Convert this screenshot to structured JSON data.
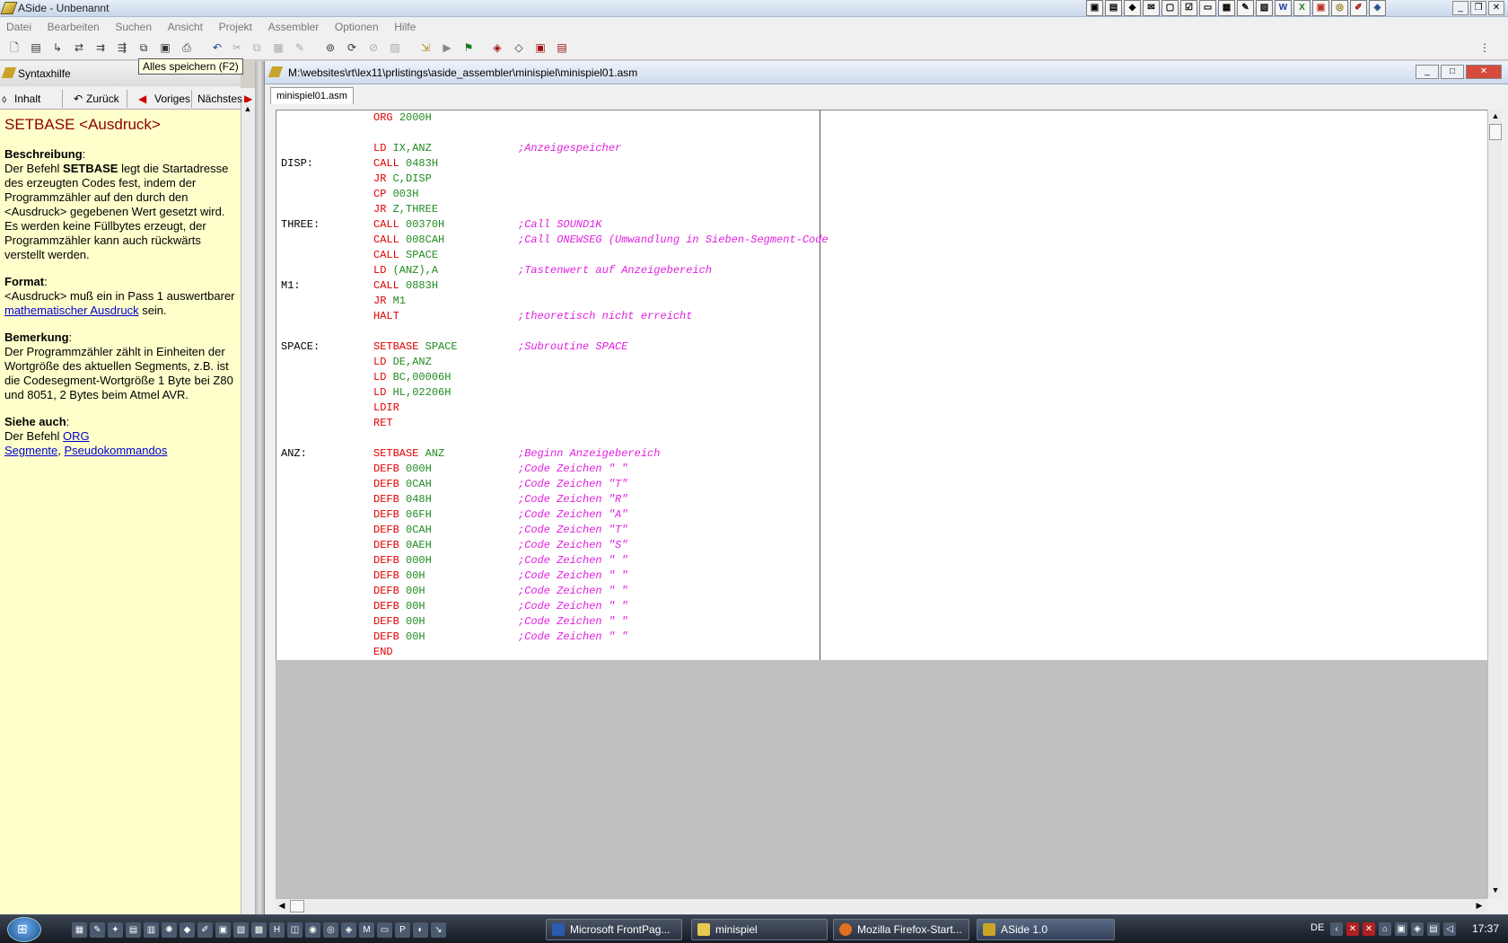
{
  "window": {
    "title": "ASide - Unbenannt"
  },
  "menu": [
    "Datei",
    "Bearbeiten",
    "Suchen",
    "Ansicht",
    "Projekt",
    "Assembler",
    "Optionen",
    "Hilfe"
  ],
  "tooltip": "Alles speichern (F2)",
  "help": {
    "pane_title": "Syntaxhilfe",
    "nav": {
      "contents": "Inhalt",
      "back": "Zurück",
      "prev": "Voriges",
      "next": "Nächstes"
    },
    "heading": "SETBASE <Ausdruck>",
    "desc_label": "Beschreibung",
    "desc_1": "Der Befehl ",
    "desc_kw": "SETBASE",
    "desc_2": " legt die Startadresse des erzeugten Codes fest, indem der Programmzähler auf den durch den <Ausdruck> gegebenen Wert gesetzt wird. Es werden keine Füllbytes erzeugt, der Programmzähler kann auch rückwärts verstellt werden.",
    "format_label": "Format",
    "format_1": "<Ausdruck> muß ein in Pass 1 auswertbarer ",
    "format_link": "mathematischer Ausdruck",
    "format_2": " sein.",
    "note_label": "Bemerkung",
    "note_text": "Der Programmzähler zählt in Einheiten der Wortgröße des aktuellen Segments, z.B. ist die Codesegment-Wortgröße 1 Byte bei Z80 und 8051, 2 Bytes beim Atmel AVR.",
    "see_label": "Siehe auch",
    "see_1": "Der Befehl ",
    "see_link_org": "ORG",
    "see_link_seg": "Segmente",
    "see_link_pseudo": "Pseudokommandos"
  },
  "document": {
    "path": "M:\\websites\\rt\\lex11\\prlistings\\aside_assembler\\minispiel\\minispiel01.asm",
    "tab": "minispiel01.asm",
    "lines": [
      {
        "label": "",
        "op": "ORG",
        "arg": "2000H",
        "comment": ""
      },
      {
        "label": "",
        "op": "",
        "arg": "",
        "comment": ""
      },
      {
        "label": "",
        "op": "LD",
        "arg": "IX,ANZ",
        "comment": ";Anzeigespeicher"
      },
      {
        "label": "DISP:",
        "op": "CALL",
        "arg": "0483H",
        "comment": ""
      },
      {
        "label": "",
        "op": "JR",
        "arg": "C,DISP",
        "comment": ""
      },
      {
        "label": "",
        "op": "CP",
        "arg": "003H",
        "comment": ""
      },
      {
        "label": "",
        "op": "JR",
        "arg": "Z,THREE",
        "comment": ""
      },
      {
        "label": "THREE:",
        "op": "CALL",
        "arg": "00370H",
        "comment": ";Call SOUND1K"
      },
      {
        "label": "",
        "op": "CALL",
        "arg": "008CAH",
        "comment": ";Call ONEWSEG (Umwandlung in Sieben-Segment-Code"
      },
      {
        "label": "",
        "op": "CALL",
        "arg": "SPACE",
        "comment": ""
      },
      {
        "label": "",
        "op": "LD",
        "arg": "(ANZ),A",
        "comment": ";Tastenwert auf Anzeigebereich"
      },
      {
        "label": "M1:",
        "op": "CALL",
        "arg": "0883H",
        "comment": ""
      },
      {
        "label": "",
        "op": "JR",
        "arg": "M1",
        "comment": ""
      },
      {
        "label": "",
        "op": "HALT",
        "arg": "",
        "comment": ";theoretisch nicht erreicht"
      },
      {
        "label": "",
        "op": "",
        "arg": "",
        "comment": ""
      },
      {
        "label": "SPACE:",
        "op": "SETBASE",
        "arg": "SPACE",
        "comment": ";Subroutine SPACE"
      },
      {
        "label": "",
        "op": "LD",
        "arg": "DE,ANZ",
        "comment": ""
      },
      {
        "label": "",
        "op": "LD",
        "arg": "BC,00006H",
        "comment": ""
      },
      {
        "label": "",
        "op": "LD",
        "arg": "HL,02206H",
        "comment": ""
      },
      {
        "label": "",
        "op": "LDIR",
        "arg": "",
        "comment": ""
      },
      {
        "label": "",
        "op": "RET",
        "arg": "",
        "comment": ""
      },
      {
        "label": "",
        "op": "",
        "arg": "",
        "comment": ""
      },
      {
        "label": "ANZ:",
        "op": "SETBASE",
        "arg": "ANZ",
        "comment": ";Beginn Anzeigebereich"
      },
      {
        "label": "",
        "op": "DEFB",
        "arg": "000H",
        "comment": ";Code Zeichen \" \""
      },
      {
        "label": "",
        "op": "DEFB",
        "arg": "0CAH",
        "comment": ";Code Zeichen \"T\""
      },
      {
        "label": "",
        "op": "DEFB",
        "arg": "048H",
        "comment": ";Code Zeichen \"R\""
      },
      {
        "label": "",
        "op": "DEFB",
        "arg": "06FH",
        "comment": ";Code Zeichen \"A\""
      },
      {
        "label": "",
        "op": "DEFB",
        "arg": "0CAH",
        "comment": ";Code Zeichen \"T\""
      },
      {
        "label": "",
        "op": "DEFB",
        "arg": "0AEH",
        "comment": ";Code Zeichen \"S\""
      },
      {
        "label": "",
        "op": "DEFB",
        "arg": "000H",
        "comment": ";Code Zeichen \" \""
      },
      {
        "label": "",
        "op": "DEFB",
        "arg": "00H",
        "comment": ";Code Zeichen \" \""
      },
      {
        "label": "",
        "op": "DEFB",
        "arg": "00H",
        "comment": ";Code Zeichen \" \""
      },
      {
        "label": "",
        "op": "DEFB",
        "arg": "00H",
        "comment": ";Code Zeichen \" \""
      },
      {
        "label": "",
        "op": "DEFB",
        "arg": "00H",
        "comment": ";Code Zeichen \" \""
      },
      {
        "label": "",
        "op": "DEFB",
        "arg": "00H",
        "comment": ";Code Zeichen \" \""
      },
      {
        "label": "",
        "op": "END",
        "arg": "",
        "comment": ""
      }
    ]
  },
  "taskbar": {
    "tasks": [
      "Microsoft FrontPag...",
      "minispiel",
      "Mozilla Firefox-Start...",
      "ASide 1.0"
    ],
    "lang": "DE",
    "clock": "17:37"
  },
  "colors": {
    "accent": "#1a4d8a",
    "help_bg": "#ffffcc",
    "keyword": "#e00000",
    "number": "#228b22",
    "comment": "#e020e0"
  }
}
